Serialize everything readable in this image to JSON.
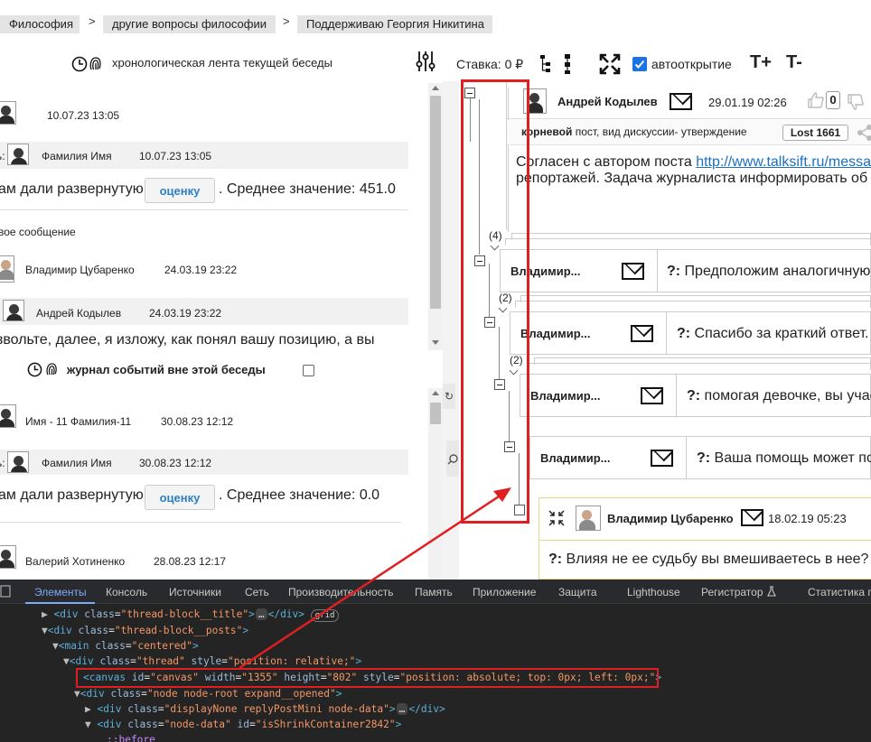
{
  "breadcrumbs": [
    "Философия",
    "другие вопросы философии",
    "Поддерживаю Георгия Никитина"
  ],
  "breadcrumb_sep": ">",
  "left": {
    "feed_title": "хронологическая лента текущей беседы",
    "feed_items": [
      {
        "time": "10.07.23 13:05"
      },
      {
        "prefix": "ь:",
        "name": "Фамилия Имя",
        "time": "10.07.23 13:05"
      },
      {
        "text_before": "ам дали развернутую",
        "button": "оценку",
        "text_after": ". Среднее значение: 451.0"
      },
      {
        "label": "вое сообщение"
      },
      {
        "name": "Владимир Цубаренко",
        "time": "24.03.19 23:22"
      },
      {
        "name": "Андрей Кодылев",
        "time": "24.03.19 23:22"
      },
      {
        "text": "звольте, далее, я изложу, как понял вашу позицию, а вы"
      }
    ],
    "journal_title": "журнал событий вне этой беседы",
    "journal_items": [
      {
        "name": "Имя - 11 Фамилия-11",
        "time": "30.08.23 12:12"
      },
      {
        "prefix": "ь:",
        "name": "Фамилия Имя",
        "time": "30.08.23 12:12"
      },
      {
        "text_before": "ам дали развернутую",
        "button": "оценку",
        "text_after": ". Среднее значение: 0.0"
      },
      {
        "name": "Валерий Хотиненко",
        "time": "28.08.23 12:17"
      }
    ]
  },
  "toolbar": {
    "stake": "Ставка: 0 ₽",
    "autoopen_label": "автооткрытие",
    "autoopen_checked": true,
    "font_plus": "T+",
    "font_minus": "T-"
  },
  "root_post": {
    "author": "Андрей Кодылев",
    "time": "29.01.19 02:26",
    "likes": "0",
    "meta_bold": "корневой",
    "meta": "пост, вид дискуссии- утверждение",
    "badge": "Lost 1661",
    "text_line1_before": "Согласен с автором поста ",
    "link": "http://www.talksift.ru/messa",
    "text_line2": "репортажей. Задача журналиста информировать об"
  },
  "replies": [
    {
      "count": "(4)",
      "author": "Владимир...",
      "q": "?:",
      "text": " Предположим аналогичную"
    },
    {
      "count": "(2)",
      "author": "Владимир...",
      "q": "?:",
      "text": " Спасибо за краткий ответ."
    },
    {
      "count": "(2)",
      "author": "Владимир...",
      "q": "?:",
      "text": " помогая девочке, вы учас"
    },
    {
      "count": "",
      "author": "Владимир...",
      "q": "?:",
      "text": " Ваша помощь может по"
    }
  ],
  "open_post": {
    "author": "Владимир Цубаренко",
    "time": "18.02.19 05:23",
    "q": "?:",
    "text": " Влияя не ее судьбу вы вмешиваетесь в нее?"
  },
  "devtools": {
    "tabs": [
      "Элементы",
      "Консоль",
      "Источники",
      "Сеть",
      "Производительность",
      "Память",
      "Приложение",
      "Защита",
      "Lighthouse",
      "Регистратор",
      "Статистика п"
    ],
    "badge": "grid",
    "ellipsis": "…",
    "lines": [
      {
        "tri": "▶",
        "tag": "<div",
        "attrs": [
          [
            "class",
            "\"thread-block__title\""
          ]
        ],
        "rest": ">",
        "close": "</div>"
      },
      {
        "tri": "▼",
        "tag": "<div",
        "attrs": [
          [
            "class",
            "\"thread-block__posts\""
          ]
        ],
        "rest": ">"
      },
      {
        "tri": "▼",
        "tag": "<main",
        "attrs": [
          [
            "class",
            "\"centered\""
          ]
        ],
        "rest": ">"
      },
      {
        "tri": "▼",
        "tag": "<div",
        "attrs": [
          [
            "class",
            "\"thread\""
          ],
          [
            "style",
            "\"position: relative;\""
          ]
        ],
        "rest": ">"
      },
      {
        "tri": "",
        "tag": "<canvas",
        "attrs": [
          [
            "id",
            "\"canvas\""
          ],
          [
            "width",
            "\"1355\""
          ],
          [
            "height",
            "\"802\""
          ],
          [
            "style",
            "\"position: absolute; top: 0px; left: 0px;\""
          ]
        ],
        "rest": ">"
      },
      {
        "tri": "▼",
        "tag": "<div",
        "attrs": [
          [
            "class",
            "\"node node-root expand__opened\""
          ]
        ],
        "rest": ">"
      },
      {
        "tri": "▶",
        "tag": "<div",
        "attrs": [
          [
            "class",
            "\"displayNone replyPostMini node-data\""
          ]
        ],
        "rest": ">",
        "close": "</div>"
      },
      {
        "tri": "▼",
        "tag": "<div",
        "attrs": [
          [
            "class",
            "\"node-data\""
          ],
          [
            "id",
            "\"isShrinkContainer2842\""
          ]
        ],
        "rest": ">"
      },
      {
        "tri": "",
        "pseudo": "::before"
      }
    ]
  },
  "colors": {
    "annotation": "#e02020",
    "link": "#1a6fc1",
    "checkbox": "#1a73e8",
    "devtools_bg": "#242424"
  }
}
